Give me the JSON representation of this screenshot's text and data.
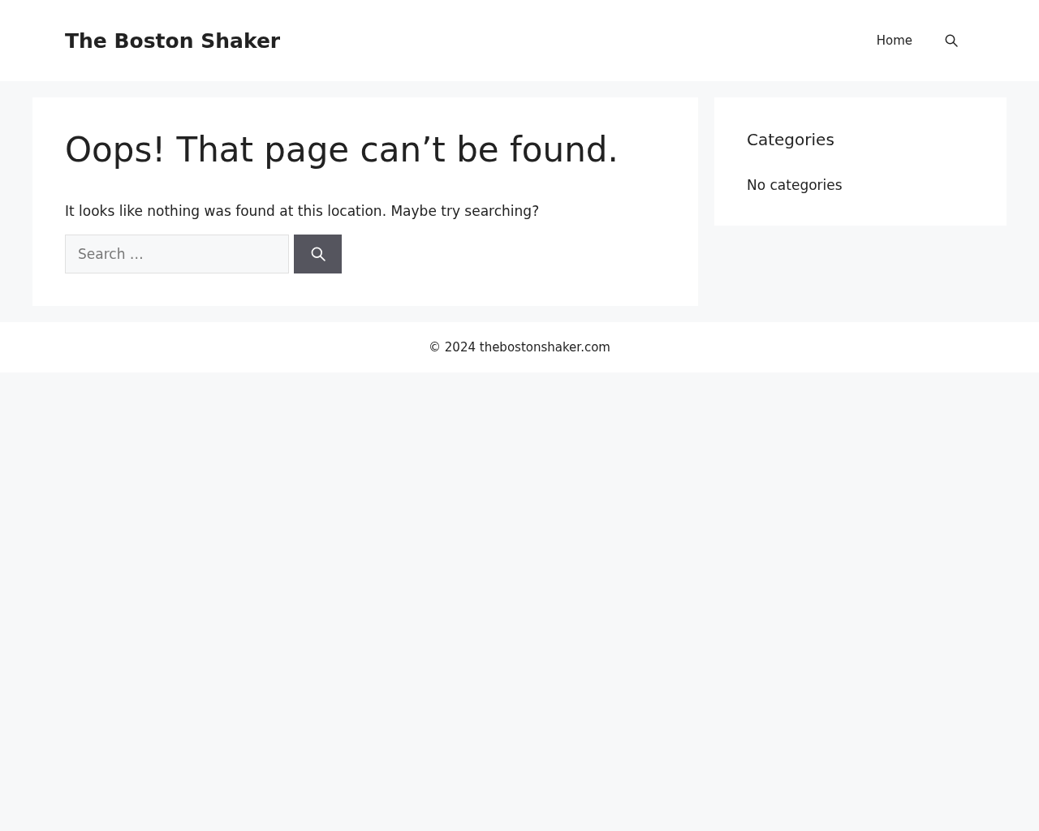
{
  "header": {
    "site_title": "The Boston Shaker",
    "nav": [
      {
        "label": "Home"
      }
    ]
  },
  "main": {
    "title": "Oops! That page can’t be found.",
    "message": "It looks like nothing was found at this location. Maybe try searching?",
    "search": {
      "placeholder": "Search …"
    }
  },
  "sidebar": {
    "title": "Categories",
    "text": "No categories"
  },
  "footer": {
    "text": "© 2024 thebostonshaker.com"
  }
}
